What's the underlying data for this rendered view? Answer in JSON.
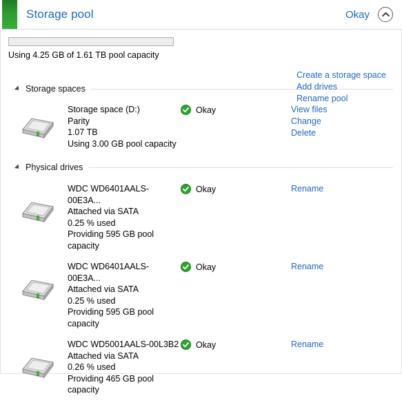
{
  "header": {
    "title": "Storage pool",
    "status": "Okay",
    "collapse_icon": "chevron-up-icon"
  },
  "pool": {
    "capacity_text": "Using 4.25 GB of 1.61 TB pool capacity",
    "bar_fill_percent": 0,
    "links": [
      "Create a storage space",
      "Add drives",
      "Rename pool"
    ]
  },
  "sections": [
    {
      "label": "Storage spaces",
      "items": [
        {
          "icon": "hard-drive-icon",
          "name": "Storage space (D:)",
          "resiliency": "Parity",
          "size": "1.07 TB",
          "usage": "Using 3.00 GB pool capacity",
          "status": "Okay",
          "status_icon": "check-circle-green-icon",
          "actions": [
            "View files",
            "Change",
            "Delete"
          ]
        }
      ]
    },
    {
      "label": "Physical drives",
      "items": [
        {
          "icon": "hard-drive-icon",
          "name": "WDC WD6401AALS-00E3A...",
          "attachment": "Attached via SATA",
          "used": "0.25 % used",
          "providing": "Providing 595 GB pool capacity",
          "status": "Okay",
          "status_icon": "check-circle-green-icon",
          "actions": [
            "Rename"
          ]
        },
        {
          "icon": "hard-drive-icon",
          "name": "WDC WD6401AALS-00E3A...",
          "attachment": "Attached via SATA",
          "used": "0.25 % used",
          "providing": "Providing 595 GB pool capacity",
          "status": "Okay",
          "status_icon": "check-circle-green-icon",
          "actions": [
            "Rename"
          ]
        },
        {
          "icon": "hard-drive-icon",
          "name": "WDC WD5001AALS-00L3B2",
          "attachment": "Attached via SATA",
          "used": "0.26 % used",
          "providing": "Providing 465 GB pool capacity",
          "status": "Okay",
          "status_icon": "check-circle-green-icon",
          "actions": [
            "Rename"
          ]
        }
      ]
    }
  ],
  "colors": {
    "link": "#1f68c4",
    "accent_green": "#2f9b2f",
    "status_green": "#2aa82a"
  }
}
